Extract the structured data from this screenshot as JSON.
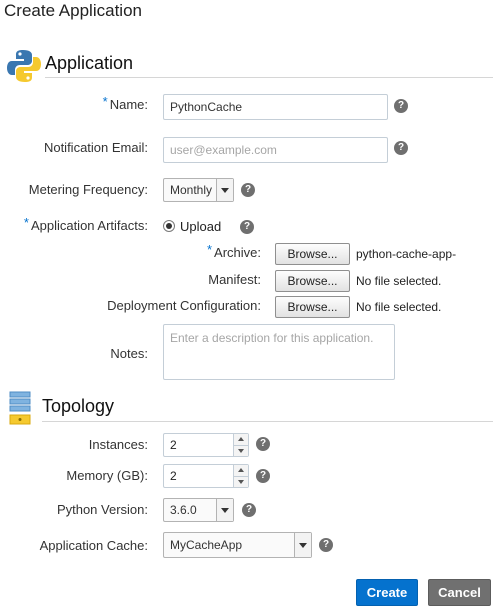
{
  "page_title": "Create Application",
  "application_section": {
    "title": "Application",
    "icon": "python-logo-icon",
    "name": {
      "required_mark": "*",
      "label": "Name:",
      "value": "PythonCache"
    },
    "notification_email": {
      "label": "Notification Email:",
      "placeholder": "user@example.com"
    },
    "metering_frequency": {
      "label": "Metering Frequency:",
      "value": "Monthly"
    },
    "artifacts": {
      "required_mark": "*",
      "label": "Application Artifacts:",
      "option": "Upload"
    },
    "archive": {
      "required_mark": "*",
      "label": "Archive:",
      "button": "Browse...",
      "file": "python-cache-app-"
    },
    "manifest": {
      "label": "Manifest:",
      "button": "Browse...",
      "file": "No file selected."
    },
    "deployment_config": {
      "label": "Deployment Configuration:",
      "button": "Browse...",
      "file": "No file selected."
    },
    "notes": {
      "label": "Notes:",
      "placeholder": "Enter a description for this application."
    }
  },
  "topology_section": {
    "title": "Topology",
    "icon": "server-stack-icon",
    "instances": {
      "label": "Instances:",
      "value": "2"
    },
    "memory": {
      "label": "Memory (GB):",
      "value": "2"
    },
    "python_version": {
      "label": "Python Version:",
      "value": "3.6.0"
    },
    "application_cache": {
      "label": "Application Cache:",
      "value": "MyCacheApp"
    }
  },
  "help_glyph": "?",
  "actions": {
    "create": "Create",
    "cancel": "Cancel"
  },
  "colors": {
    "primary": "#0572ce",
    "secondary": "#707070",
    "required": "#0572ce",
    "python_blue": "#3a77b0",
    "python_yellow": "#f5c92f"
  }
}
